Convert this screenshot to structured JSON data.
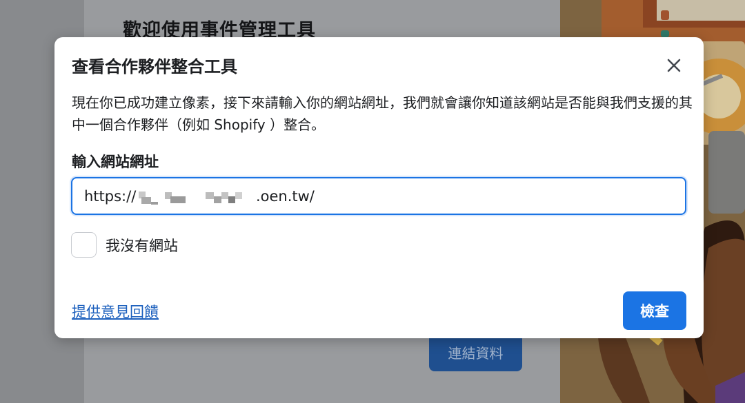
{
  "background_page": {
    "title": "歡迎使用事件管理工具",
    "connect_button_label": "連結資料"
  },
  "dialog": {
    "title": "查看合作夥伴整合工具",
    "close_icon": "close-icon",
    "description": "現在你已成功建立像素，接下來請輸入你的網站網址，我們就會讓你知道該網站是否能與我們支援的其中一個合作夥伴（例如 Shopify ）整合。",
    "url_field": {
      "label": "輸入網站網址",
      "value": "https://.oen.tw/"
    },
    "no_website_checkbox": {
      "label": "我沒有網站",
      "checked": false
    },
    "feedback_link": "提供意見回饋",
    "check_button_label": "檢查"
  },
  "colors": {
    "primary": "#1b74e4",
    "link": "#1b5fbd",
    "text": "#1c1e21",
    "overlay": "#8f8f8f"
  }
}
